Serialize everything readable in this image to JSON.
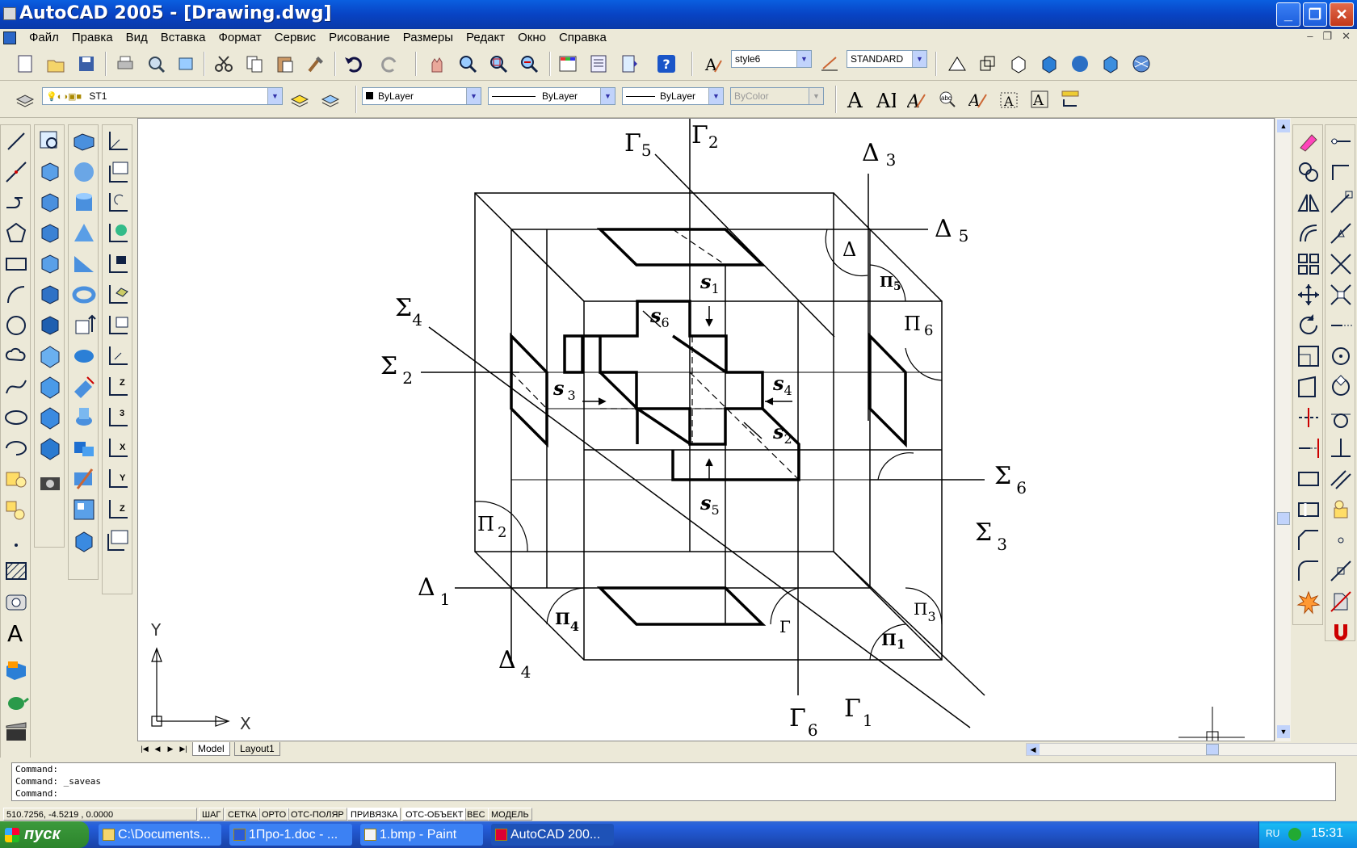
{
  "window": {
    "title": "AutoCAD 2005 - [Drawing.dwg]",
    "minimize": "_",
    "maximize": "❐",
    "close": "✕"
  },
  "menu": {
    "items": [
      "Файл",
      "Правка",
      "Вид",
      "Вставка",
      "Формат",
      "Сервис",
      "Рисование",
      "Размеры",
      "Редакт",
      "Окно",
      "Справка"
    ],
    "mdi": [
      "–",
      "❐",
      "✕"
    ]
  },
  "toolbar": {
    "text_style": "style6",
    "dim_style": "STANDARD",
    "layer": "ST1",
    "color": "ByLayer",
    "linetype": "ByLayer",
    "lineweight": "ByLayer",
    "plotstyle": "ByColor"
  },
  "tabs": {
    "model": "Model",
    "layout": "Layout1"
  },
  "command": {
    "lines": [
      "Command:",
      "Command: _saveas",
      "Command:"
    ]
  },
  "status": {
    "coords": "510.7256, -4.5219 , 0.0000",
    "toggles": [
      "ШАГ",
      "СЕТКА",
      "ОРТО",
      "ОТС-ПОЛЯР",
      "ПРИВЯЗКА",
      "ОТС-ОБЪЕКТ",
      "ВЕС",
      "МОДЕЛЬ"
    ]
  },
  "taskbar": {
    "start": "пуск",
    "tasks": [
      "C:\\Documents...",
      "1Про-1.doc - ...",
      "1.bmp - Paint",
      "AutoCAD 200..."
    ],
    "lang": "RU",
    "clock": "15:31"
  },
  "drawing": {
    "ucs": {
      "x": "X",
      "y": "Y"
    },
    "labels": {
      "g2": {
        "main": "Γ",
        "sub": "2"
      },
      "g5": {
        "main": "Γ",
        "sub": "5"
      },
      "d3": {
        "main": "Δ",
        "sub": "3"
      },
      "d5": {
        "main": "Δ",
        "sub": "5"
      },
      "s4": {
        "main": "Σ",
        "sub": "4"
      },
      "s2": {
        "main": "Σ",
        "sub": "2"
      },
      "s6": {
        "main": "Σ",
        "sub": "6"
      },
      "s3": {
        "main": "Σ",
        "sub": "3"
      },
      "d1": {
        "main": "Δ",
        "sub": "1"
      },
      "d4": {
        "main": "Δ",
        "sub": "4"
      },
      "g6": {
        "main": "Γ",
        "sub": "6"
      },
      "g1": {
        "main": "Γ",
        "sub": "1"
      },
      "p2": {
        "main": "Π",
        "sub": "2"
      },
      "p6": {
        "main": "Π",
        "sub": "6"
      },
      "p5": {
        "main": "Π",
        "sub": "5"
      },
      "p4": {
        "main": "Π",
        "sub": "4"
      },
      "p3": {
        "main": "Π",
        "sub": "3"
      },
      "p1": {
        "main": "Π",
        "sub": "1"
      },
      "delta": {
        "main": "Δ",
        "sub": ""
      },
      "gamma": {
        "main": "Γ",
        "sub": ""
      },
      "sv1": {
        "main": "s",
        "sub": "1"
      },
      "sv2": {
        "main": "s",
        "sub": "2"
      },
      "sv3": {
        "main": "s",
        "sub": "3"
      },
      "sv4": {
        "main": "s",
        "sub": "4"
      },
      "sv5": {
        "main": "s",
        "sub": "5"
      },
      "sv6": {
        "main": "s",
        "sub": "6"
      }
    }
  }
}
